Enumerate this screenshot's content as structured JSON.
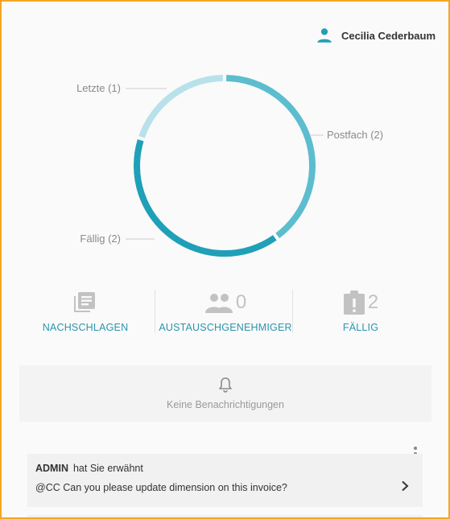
{
  "user": {
    "name": "Cecilia Cederbaum",
    "icon": "person-icon"
  },
  "donut": {
    "segments": [
      {
        "label": "Postfach (2)",
        "value": 2,
        "color": "#5cbdce"
      },
      {
        "label": "Fällig (2)",
        "value": 2,
        "color": "#1fa0b8"
      },
      {
        "label": "Letzte (1)",
        "value": 1,
        "color": "#b8e1ea"
      }
    ]
  },
  "stats": [
    {
      "icon": "library-books-icon",
      "count": "",
      "label": "NACHSCHLAGEN"
    },
    {
      "icon": "people-icon",
      "count": "0",
      "label": "AUSTAUSCHGENEHMIGER"
    },
    {
      "icon": "clipboard-alert-icon",
      "count": "2",
      "label": "FÄLLIG"
    }
  ],
  "notifications": {
    "empty_text": "Keine Benachrichtigungen",
    "icon": "bell-icon"
  },
  "mention": {
    "author": "ADMIN",
    "action": "hat Sie erwähnt",
    "message": "@CC Can you please update dimension on this invoice?"
  }
}
